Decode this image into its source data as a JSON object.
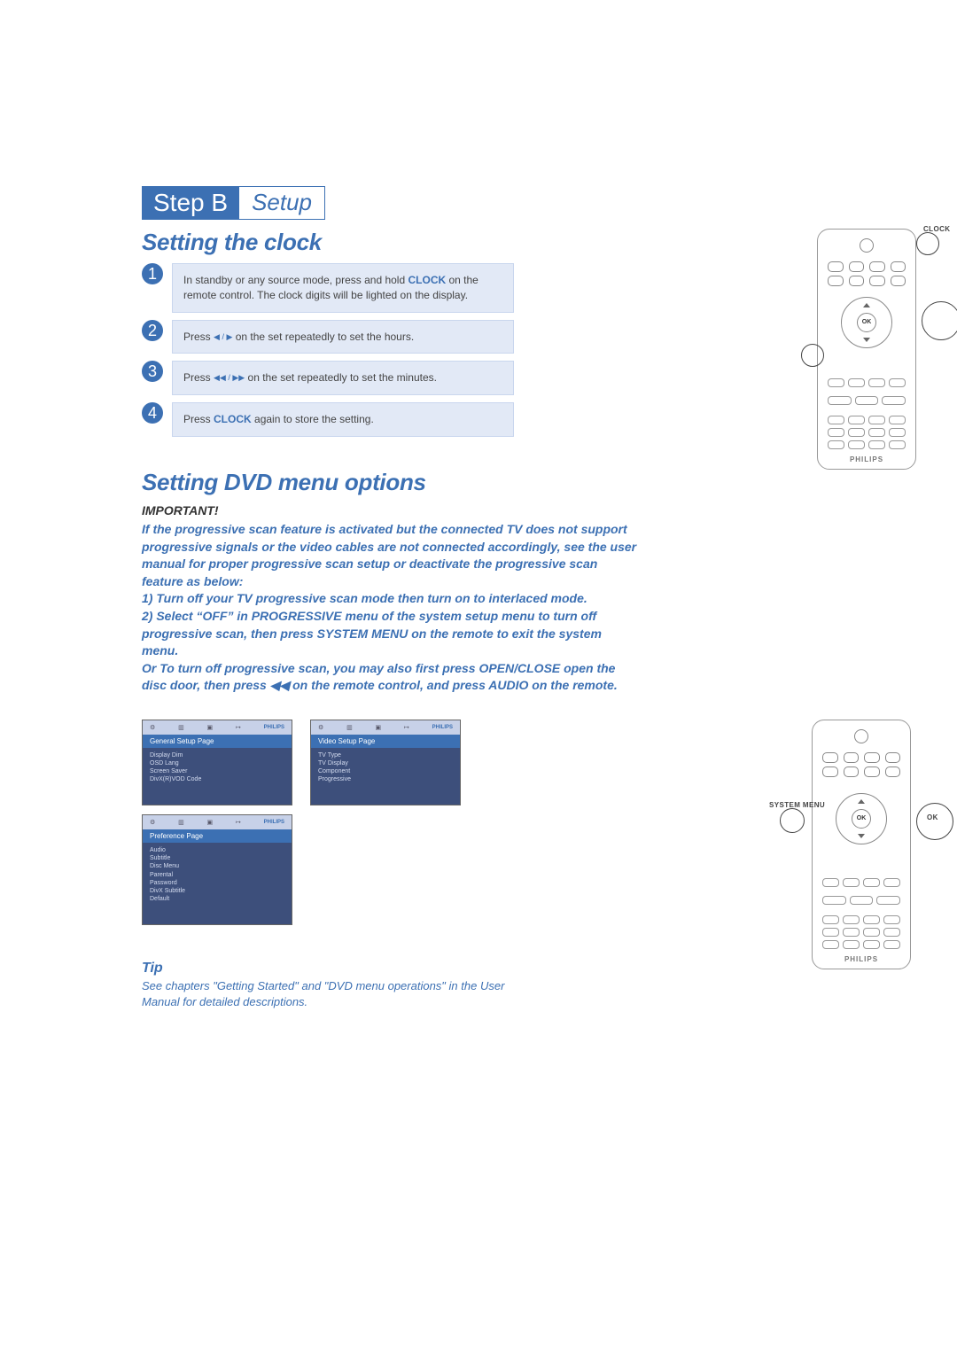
{
  "step_label_prefix": "Step B",
  "step_label_title": "Setup",
  "section_clock_title": "Setting the clock",
  "section_dvd_title": "Setting DVD menu options",
  "steps": {
    "s1": {
      "num": "1",
      "text_a": "In standby or any source mode, press and hold ",
      "clock": "CLOCK",
      "text_b": " on the remote control. The clock digits will be lighted on the display."
    },
    "s2": {
      "num": "2",
      "text_a": "Press ",
      "sym": "◀ / ▶",
      "text_b": " on the set repeatedly to set the hours."
    },
    "s3": {
      "num": "3",
      "text_a": "Press  ",
      "sym": "◀◀ / ▶▶",
      "text_b": " on the set repeatedly to set the minutes."
    },
    "s4": {
      "num": "4",
      "text_a": "Press ",
      "clock": "CLOCK",
      "text_b": " again to store the setting."
    }
  },
  "callouts": {
    "clock": "CLOCK",
    "ok": "OK",
    "system_menu": "SYSTEM MENU"
  },
  "important": {
    "title": "IMPORTANT!",
    "body": "If the progressive scan feature is activated but the connected TV does not support progressive signals or the video cables are not connected accordingly, see the user manual for proper progressive scan setup or deactivate the progressive scan feature as below:\n1) Turn off your TV progressive scan mode then turn on to interlaced mode.\n2) Select “OFF” in PROGRESSIVE menu of the system setup menu to turn off progressive scan, then press SYSTEM MENU on the remote to exit the system menu.\nOr To turn off progressive scan, you may also first press OPEN/CLOSE open the disc door, then press ◀◀ on the remote control, and press AUDIO on the remote."
  },
  "tip": {
    "title": "Tip",
    "body": "See chapters \"Getting Started\" and \"DVD menu operations\" in the User Manual for detailed descriptions."
  },
  "menus": {
    "brand": "PHILIPS",
    "general": {
      "title": "General Setup Page",
      "items": [
        "Display Dim",
        "OSD Lang",
        "Screen Saver",
        "DivX(R)VOD Code"
      ]
    },
    "video": {
      "title": "Video Setup Page",
      "items": [
        "TV Type",
        "TV Display",
        "Component",
        "Progressive"
      ]
    },
    "preference": {
      "title": "Preference Page",
      "items": [
        "Audio",
        "Subtitle",
        "Disc Menu",
        "Parental",
        "Password",
        "DivX Subtitle",
        "Default"
      ]
    }
  },
  "remote_brand": "PHILIPS"
}
